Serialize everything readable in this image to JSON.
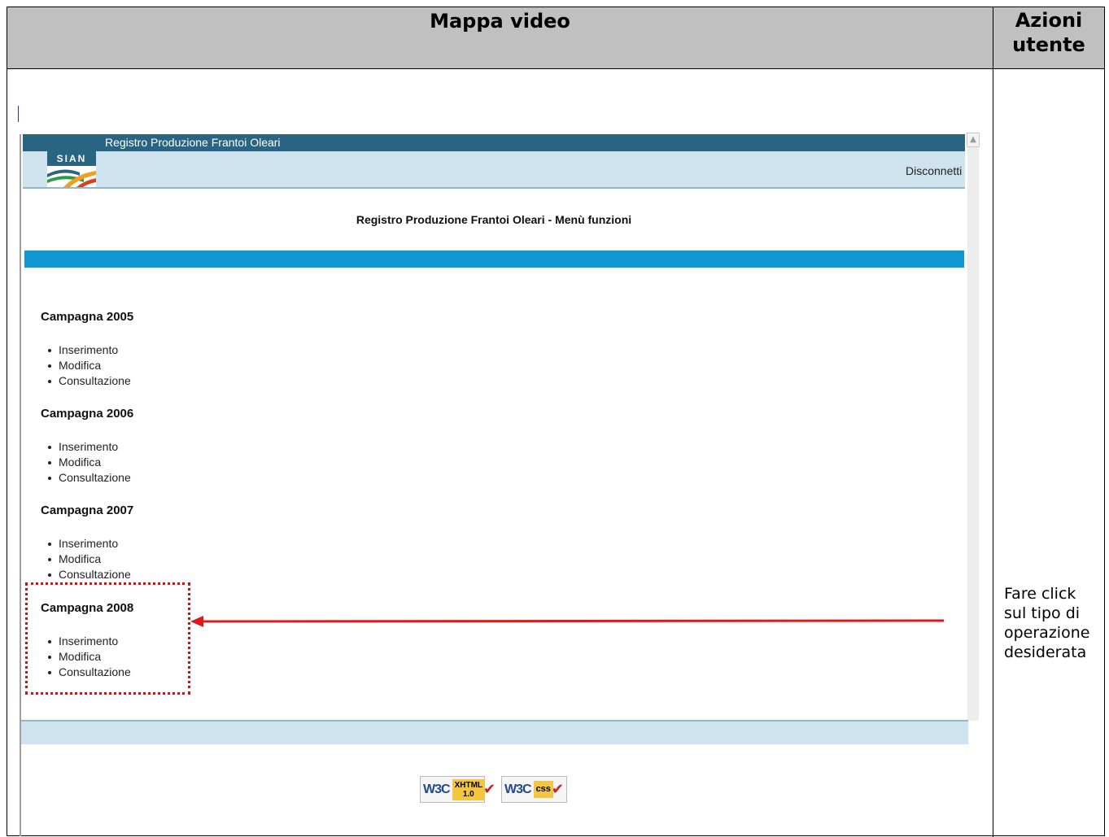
{
  "document": {
    "col1_header": "Mappa video",
    "col2_header_line1": "Azioni",
    "col2_header_line2": "utente",
    "user_actions_text": "Fare click sul tipo di operazione desiderata"
  },
  "app": {
    "title": "Registro Produzione Frantoi Oleari",
    "logo_text": "SIAN",
    "logout_label": "Disconnetti",
    "page_heading": "Registro Produzione Frantoi Oleari - Menù funzioni",
    "campaigns": [
      {
        "title": "Campagna 2005",
        "items": [
          "Inserimento",
          "Modifica",
          "Consultazione"
        ]
      },
      {
        "title": "Campagna 2006",
        "items": [
          "Inserimento",
          "Modifica",
          "Consultazione"
        ]
      },
      {
        "title": "Campagna 2007",
        "items": [
          "Inserimento",
          "Modifica",
          "Consultazione"
        ]
      },
      {
        "title": "Campagna 2008",
        "items": [
          "Inserimento",
          "Modifica",
          "Consultazione"
        ]
      }
    ],
    "badges": {
      "xhtml_w3c": "W3C",
      "xhtml_line1": "XHTML",
      "xhtml_line2": "1.0",
      "css_w3c": "W3C",
      "css_label": "css"
    }
  },
  "colors": {
    "titlebar": "#2a6483",
    "band": "#1196d4",
    "subbar": "#cfe3ef",
    "highlight": "#d11010"
  }
}
